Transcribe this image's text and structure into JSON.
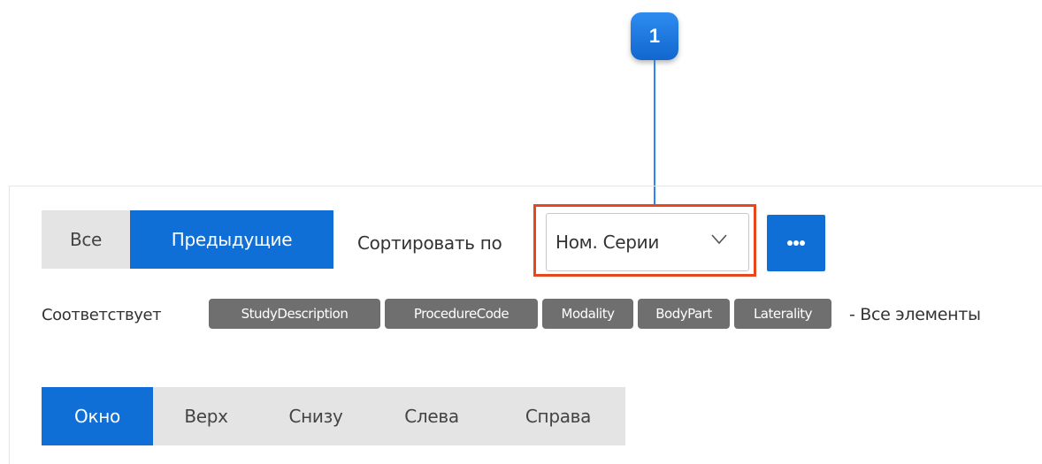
{
  "callout": {
    "number": "1"
  },
  "filter_toggle": {
    "all_label": "Все",
    "previous_label": "Предыдущие"
  },
  "sort": {
    "label": "Сортировать по",
    "selected": "Ном. Серии"
  },
  "more_button": {
    "icon": "ellipsis-icon"
  },
  "match": {
    "label": "Соответствует",
    "tags": [
      "StudyDescription",
      "ProcedureCode",
      "Modality",
      "BodyPart",
      "Laterality"
    ],
    "suffix": "- Все элементы"
  },
  "position_tabs": [
    "Окно",
    "Верх",
    "Снизу",
    "Слева",
    "Справа"
  ],
  "colors": {
    "accent": "#0f6fd6",
    "callout": "#1a78e6",
    "highlight": "#e8461e",
    "tag_bg": "#6f6f6f",
    "inactive_bg": "#e4e4e4"
  }
}
